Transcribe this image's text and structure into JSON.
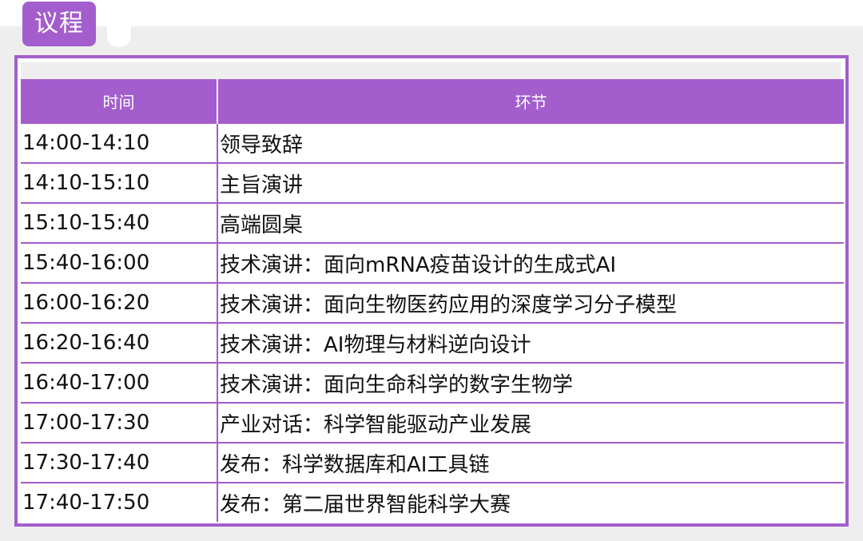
{
  "section_tag": "议程",
  "table": {
    "headers": {
      "time": "时间",
      "item": "环节"
    },
    "rows": [
      {
        "time": "14:00-14:10",
        "item": "领导致辞"
      },
      {
        "time": "14:10-15:10",
        "item": "主旨演讲"
      },
      {
        "time": "15:10-15:40",
        "item": "高端圆桌"
      },
      {
        "time": "15:40-16:00",
        "item": "技术演讲：面向mRNA疫苗设计的生成式AI"
      },
      {
        "time": "16:00-16:20",
        "item": "技术演讲：面向生物医药应用的深度学习分子模型"
      },
      {
        "time": "16:20-16:40",
        "item": "技术演讲：AI物理与材料逆向设计"
      },
      {
        "time": "16:40-17:00",
        "item": "技术演讲：面向生命科学的数字生物学"
      },
      {
        "time": "17:00-17:30",
        "item": "产业对话：科学智能驱动产业发展"
      },
      {
        "time": "17:30-17:40",
        "item": "发布：科学数据库和AI工具链"
      },
      {
        "time": "17:40-17:50",
        "item": "发布：第二届世界智能科学大赛"
      }
    ]
  },
  "colors": {
    "accent": "#a35dcd",
    "background": "#eeeeee"
  }
}
